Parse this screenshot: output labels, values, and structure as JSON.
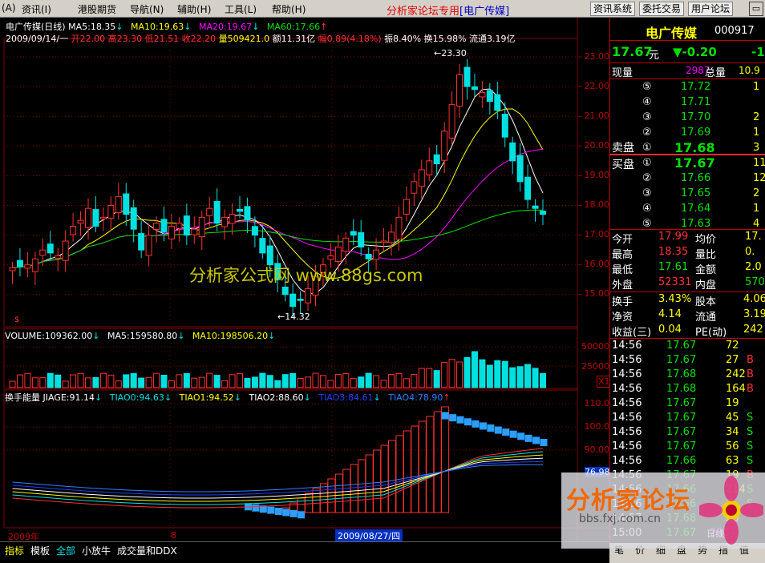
{
  "menu": {
    "items": [
      "(A)",
      "资讯(I)",
      "港股期货",
      "导航(N)",
      "辅助(H)",
      "工具(L)",
      "帮助(H)"
    ],
    "forum": "分析家论坛专用",
    "stock_tag": "[电广传媒]",
    "btn_info": "资讯系统",
    "btn_trade": "委托交易",
    "btn_forum": "用户论坛",
    "win_icon": "▭"
  },
  "info": {
    "name": "电广传媒(日线)",
    "ma5": "MA5:18.35",
    "ma10": "MA10:19.63",
    "ma20": "MA20:19.67",
    "ma60": "MA60:17.66",
    "arrow_up": "↑",
    "arrow_down": "↓",
    "line2_date": "2009/09/14/一",
    "line2_open": "开22.00",
    "line2_high": "高23.30",
    "line2_low": "低21.51",
    "line2_close": "收22.20",
    "line2_vol": "量509421.0",
    "line2_amt": "额11.31亿",
    "line2_amp": "幅0.89(4.18%)",
    "line2_rest": "振8.40% 换15.98% 流通3.19亿"
  },
  "yaxis": [
    "23.00",
    "22.00",
    "21.00",
    "20.00",
    "19.00",
    "18.00",
    "17.00",
    "16.00",
    "15.00"
  ],
  "vol": {
    "label": "VOLUME:109362.00",
    "ma5": "MA5:159580.80",
    "ma10": "MA10:198506.20",
    "arrow": "↓",
    "y1": "50000",
    "y2": "25000",
    "x10": "X10"
  },
  "ind": {
    "label": "换手能量",
    "jiage": "JIAGE:91.14",
    "tiao0": "TIAO0:94.63",
    "tiao1": "TIAO1:94.52",
    "tiao2": "TIAO2:88.60",
    "tiao3": "TIAO3:84.61",
    "tiao4": "TIAO4:78.90",
    "arrow_d": "↓",
    "arrow_u": "↑",
    "y": [
      "110.0",
      "100.0",
      "90.00"
    ],
    "cur": "76.98"
  },
  "marks": {
    "high": "23.30",
    "low": "14.32",
    "watermark": "分析家公式网 www.88gs.com",
    "dollar": "$"
  },
  "xaxis": {
    "year": "2009年",
    "m8": "8",
    "cursor_date": "2009/08/27/四"
  },
  "bottom": {
    "tabs": [
      "指标",
      "模板",
      "全部",
      "小放牛",
      "成交量和DDX"
    ]
  },
  "quote": {
    "name": "电广传媒",
    "code": "000917",
    "price": "17.67",
    "unit": "元",
    "chg_arrow": "▼",
    "chg": "-0.20",
    "chg2": "-1",
    "xianliang_label": "现量",
    "xianliang": "2987",
    "zongliang_label": "总量",
    "zongliang": "10.9",
    "sell_label": "卖盘",
    "buy_label": "买盘",
    "sells": [
      {
        "lvl": "⑤",
        "price": "17.72",
        "vol": "1"
      },
      {
        "lvl": "④",
        "price": "17.71",
        "vol": ""
      },
      {
        "lvl": "③",
        "price": "17.70",
        "vol": "2"
      },
      {
        "lvl": "②",
        "price": "17.69",
        "vol": "1"
      },
      {
        "lvl": "①",
        "price": "17.68",
        "vol": "3"
      }
    ],
    "buys": [
      {
        "lvl": "①",
        "price": "17.67",
        "vol": "11"
      },
      {
        "lvl": "②",
        "price": "17.66",
        "vol": "12"
      },
      {
        "lvl": "③",
        "price": "17.65",
        "vol": "2"
      },
      {
        "lvl": "④",
        "price": "17.64",
        "vol": "1"
      },
      {
        "lvl": "⑤",
        "price": "17.63",
        "vol": "4"
      }
    ],
    "stats": [
      {
        "l1": "今开",
        "v1": "17.99",
        "l2": "均价",
        "v2": "17."
      },
      {
        "l1": "最高",
        "v1": "18.35",
        "l2": "量比",
        "v2": "0."
      },
      {
        "l1": "最低",
        "v1": "17.61",
        "l2": "金额",
        "v2": "2.0"
      },
      {
        "l1": "外盘",
        "v1": "52331",
        "l2": "内盘",
        "v2": "570"
      }
    ],
    "fin": [
      {
        "l1": "换手",
        "v1": "3.43%",
        "l2": "股本",
        "v2": "4.06"
      },
      {
        "l1": "净资",
        "v1": "4.14",
        "l2": "流通",
        "v2": "3.19"
      },
      {
        "l1": "收益(三)",
        "v1": "0.04",
        "l2": "PE(动)",
        "v2": "242"
      }
    ],
    "ticks": [
      {
        "t": "14:56",
        "p": "17.67",
        "v": "72",
        "s": ""
      },
      {
        "t": "14:56",
        "p": "17.67",
        "v": "27",
        "s": "B"
      },
      {
        "t": "14:56",
        "p": "17.68",
        "v": "242",
        "s": "B"
      },
      {
        "t": "14:56",
        "p": "17.68",
        "v": "164",
        "s": "B"
      },
      {
        "t": "14:56",
        "p": "17.67",
        "v": "19",
        "s": ""
      },
      {
        "t": "14:56",
        "p": "17.67",
        "v": "45",
        "s": "S"
      },
      {
        "t": "14:56",
        "p": "17.67",
        "v": "34",
        "s": "S"
      },
      {
        "t": "14:56",
        "p": "17.67",
        "v": "56",
        "s": "S"
      },
      {
        "t": "14:56",
        "p": "17.66",
        "v": "63",
        "s": "S"
      },
      {
        "t": "14:56",
        "p": "17.67",
        "v": "19",
        "s": "B"
      },
      {
        "t": "14:56",
        "p": "17.66",
        "v": "214",
        "s": "S"
      },
      {
        "t": "14:56",
        "p": "17.66",
        "v": "3",
        "s": "S"
      },
      {
        "t": "14:57",
        "p": "17.68",
        "v": "20",
        "s": ""
      },
      {
        "t": "15:00",
        "p": "17.67",
        "v": "2987",
        "s": ""
      }
    ],
    "day": "日线",
    "footer": [
      "笔",
      "价",
      "细",
      "盘",
      "势",
      "指",
      "值"
    ]
  },
  "logo": {
    "text": "分析家论坛",
    "url": "bbs.fxj.com.cn"
  },
  "colors": {
    "up": "#ff3030",
    "down": "#00e0e0",
    "ma5": "#ffffff",
    "ma10": "#ffff00",
    "ma20": "#ff00ff",
    "ma60": "#00e000",
    "grid": "#800000"
  }
}
